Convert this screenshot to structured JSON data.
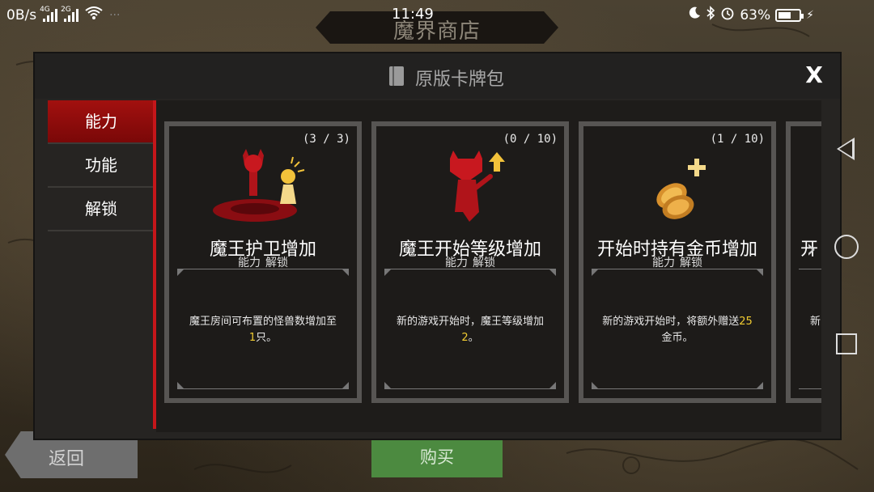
{
  "status_bar": {
    "speed": "0B/s",
    "net1": "4G",
    "net2": "2G",
    "time": "11:49",
    "battery": "63%",
    "battery_level": 0.63
  },
  "shop_title": "魔界商店",
  "dialog": {
    "title": "原版卡牌包",
    "close_label": "X"
  },
  "sidebar": {
    "items": [
      {
        "label": "能力",
        "active": true
      },
      {
        "label": "功能",
        "active": false
      },
      {
        "label": "解锁",
        "active": false
      }
    ]
  },
  "cards": [
    {
      "count": "(3 / 3)",
      "title": "魔王护卫增加",
      "tag1": "能力",
      "tag2": "解锁",
      "desc_before": "魔王房间可布置的怪兽数增加至",
      "desc_highlight": "1",
      "desc_after": "只。",
      "icon": "demon-guard-icon"
    },
    {
      "count": "(0 / 10)",
      "title": "魔王开始等级增加",
      "tag1": "能力",
      "tag2": "解锁",
      "desc_before": "新的游戏开始时，魔王等级增加",
      "desc_highlight": "2",
      "desc_after": "。",
      "icon": "demon-level-up-icon"
    },
    {
      "count": "(1 / 10)",
      "title": "开始时持有金币增加",
      "tag1": "能力",
      "tag2": "解锁",
      "desc_before": "新的游戏开始时，将额外赠送",
      "desc_highlight": "25",
      "desc_after": "金币。",
      "icon": "gold-coins-plus-icon"
    },
    {
      "count": "",
      "title": "开",
      "tag1": "",
      "tag2": "",
      "desc_before": "新",
      "desc_highlight": "",
      "desc_after": "",
      "icon": ""
    }
  ],
  "footer": {
    "back_label": "返回",
    "buy_label": "购买"
  },
  "colors": {
    "accent_red": "#c5161a",
    "highlight_yellow": "#f1cc31",
    "buy_green": "#4c8a40"
  }
}
